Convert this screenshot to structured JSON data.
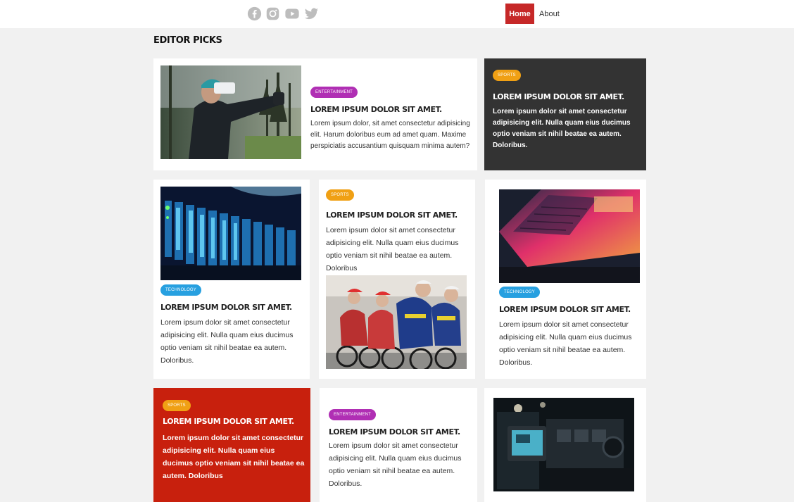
{
  "header": {
    "social": [
      "facebook-icon",
      "instagram-icon",
      "youtube-icon",
      "twitter-icon"
    ],
    "nav": {
      "home": "Home",
      "about": "About"
    },
    "accent": "#c62828"
  },
  "section": {
    "title": "EDITOR PICKS"
  },
  "cards": {
    "c1": {
      "badge": "ENTERTAINMENT",
      "title": "LOREM IPSUM DOLOR SIT AMET.",
      "text": "Lorem ipsum dolor, sit amet consectetur adipisicing elit. Harum doloribus eum ad amet quam. Maxime perspiciatis accusantium quisquam minima autem?"
    },
    "c2": {
      "badge": "SPORTS",
      "title": "LOREM IPSUM DOLOR SIT AMET.",
      "text": "Lorem ipsum dolor sit amet consectetur adipisicing elit. Nulla quam eius ducimus optio veniam sit nihil beatae ea autem. Doloribus."
    },
    "c3": {
      "badge": "TECHNOLOGY",
      "title": "LOREM IPSUM DOLOR SIT AMET.",
      "text": "Lorem ipsum dolor sit amet consectetur adipisicing elit. Nulla quam eius ducimus optio veniam sit nihil beatae ea autem. Doloribus."
    },
    "c4": {
      "badge": "SPORTS",
      "title": "LOREM IPSUM DOLOR SIT AMET.",
      "text": "Lorem ipsum dolor sit amet consectetur adipisicing elit. Nulla quam eius ducimus optio veniam sit nihil beatae ea autem. Doloribus"
    },
    "c5": {
      "badge": "TECHNOLOGY",
      "title": "LOREM IPSUM DOLOR SIT AMET.",
      "text": "Lorem ipsum dolor sit amet consectetur adipisicing elit. Nulla quam eius ducimus optio veniam sit nihil beatae ea autem. Doloribus."
    },
    "c6": {
      "badge": "SPORTS",
      "title": "LOREM IPSUM DOLOR SIT AMET.",
      "text": "Lorem ipsum dolor sit amet consectetur adipisicing elit. Nulla quam eius ducimus optio veniam sit nihil beatae ea autem. Doloribus"
    },
    "c7": {
      "badge": "ENTERTAINMENT",
      "title": "LOREM IPSUM DOLOR SIT AMET.",
      "text": "Lorem ipsum dolor sit amet consectetur adipisicing elit. Nulla quam eius ducimus optio veniam sit nihil beatae ea autem. Doloribus."
    }
  },
  "colors": {
    "entertainment": "#b02fb4",
    "sports": "#f0a014",
    "technology": "#27a0e0",
    "dark_card": "#333333",
    "red_card": "#c8200d"
  }
}
